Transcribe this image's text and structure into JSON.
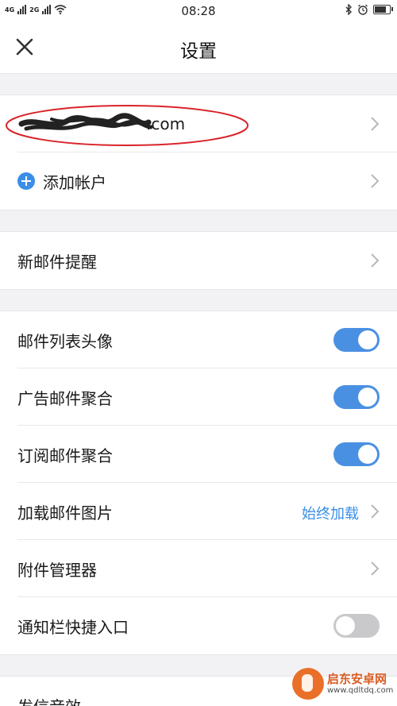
{
  "status_bar": {
    "network_1": "4G",
    "network_2": "2G",
    "time": "08:28"
  },
  "header": {
    "title": "设置"
  },
  "account": {
    "email_visible": ".com"
  },
  "add_account": {
    "label": "添加帐户"
  },
  "new_mail_alert": {
    "label": "新邮件提醒"
  },
  "settings": [
    {
      "label": "邮件列表头像",
      "toggle_on": true
    },
    {
      "label": "广告邮件聚合",
      "toggle_on": true
    },
    {
      "label": "订阅邮件聚合",
      "toggle_on": true
    }
  ],
  "load_images": {
    "label": "加载邮件图片",
    "value": "始终加载"
  },
  "attachment_manager": {
    "label": "附件管理器"
  },
  "notification_shortcut": {
    "label": "通知栏快捷入口",
    "toggle_on": false
  },
  "partial_row": {
    "label": "发信音效"
  },
  "watermark": {
    "title": "启东安卓网",
    "url": "www.qdltdq.com"
  },
  "colors": {
    "accent": "#4a90e2",
    "link_value": "#3a8ee6",
    "annotation_circle": "#d9242b"
  }
}
